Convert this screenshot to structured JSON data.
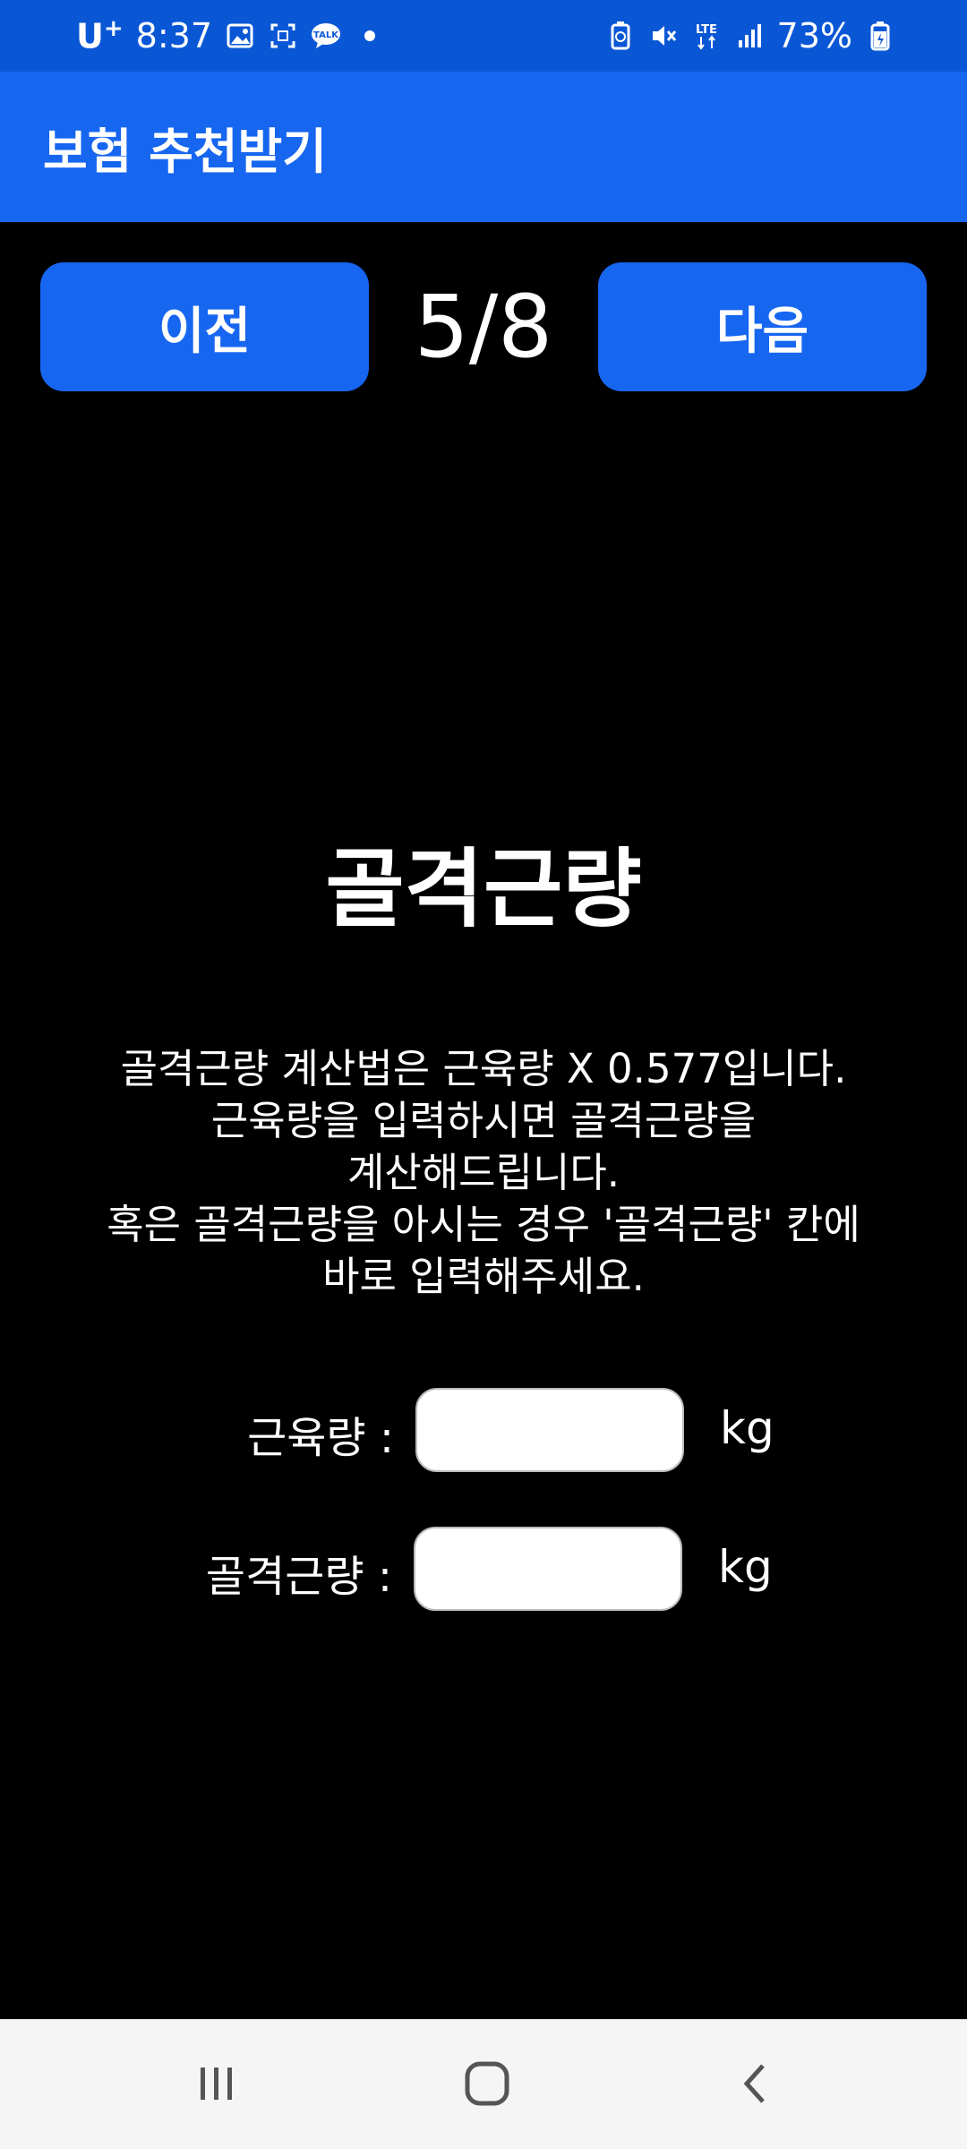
{
  "status_bar": {
    "carrier": "U",
    "carrier_plus": "+",
    "time": "8:37",
    "battery_percent": "73%",
    "network": "LTE",
    "icons": [
      "gallery-icon",
      "screenshot-icon",
      "kakaotalk-icon",
      "notification-dot-icon",
      "battery-saver-icon",
      "mute-icon",
      "lte-icon",
      "signal-icon",
      "battery-icon"
    ]
  },
  "app_bar": {
    "title": "보험 추천받기"
  },
  "navigation": {
    "prev_label": "이전",
    "next_label": "다음",
    "step": "5/8"
  },
  "section": {
    "title": "골격근량",
    "description_lines": [
      "골격근량 계산법은 근육량 X 0.577입니다.",
      "근육량을 입력하시면 골격근량을",
      "계산해드립니다.",
      "혹은 골격근량을 아시는 경우 '골격근량' 칸에",
      "바로 입력해주세요."
    ]
  },
  "form": {
    "muscle_label": "근육량 :",
    "muscle_value": "",
    "muscle_unit": "kg",
    "skeletal_label": "골격근량 :",
    "skeletal_value": "",
    "skeletal_unit": "kg"
  },
  "system_nav": {
    "icons": [
      "recents-icon",
      "home-icon",
      "back-icon"
    ]
  },
  "colors": {
    "status_bar": "#0a57d6",
    "app_bar": "#1766f0",
    "button": "#1766f0",
    "background": "#000000"
  }
}
